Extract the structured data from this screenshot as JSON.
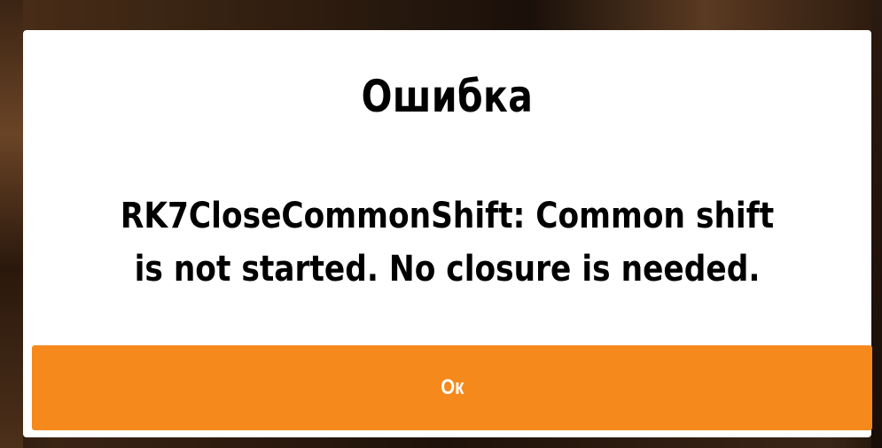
{
  "dialog": {
    "title": "Ошибка",
    "message": "RK7CloseCommonShift: Common shift is not started. No closure is needed.",
    "ok_label": "Ок"
  },
  "colors": {
    "button_bg": "#f5891c",
    "dialog_bg": "#ffffff",
    "text": "#000000",
    "button_text": "#ffffff"
  }
}
